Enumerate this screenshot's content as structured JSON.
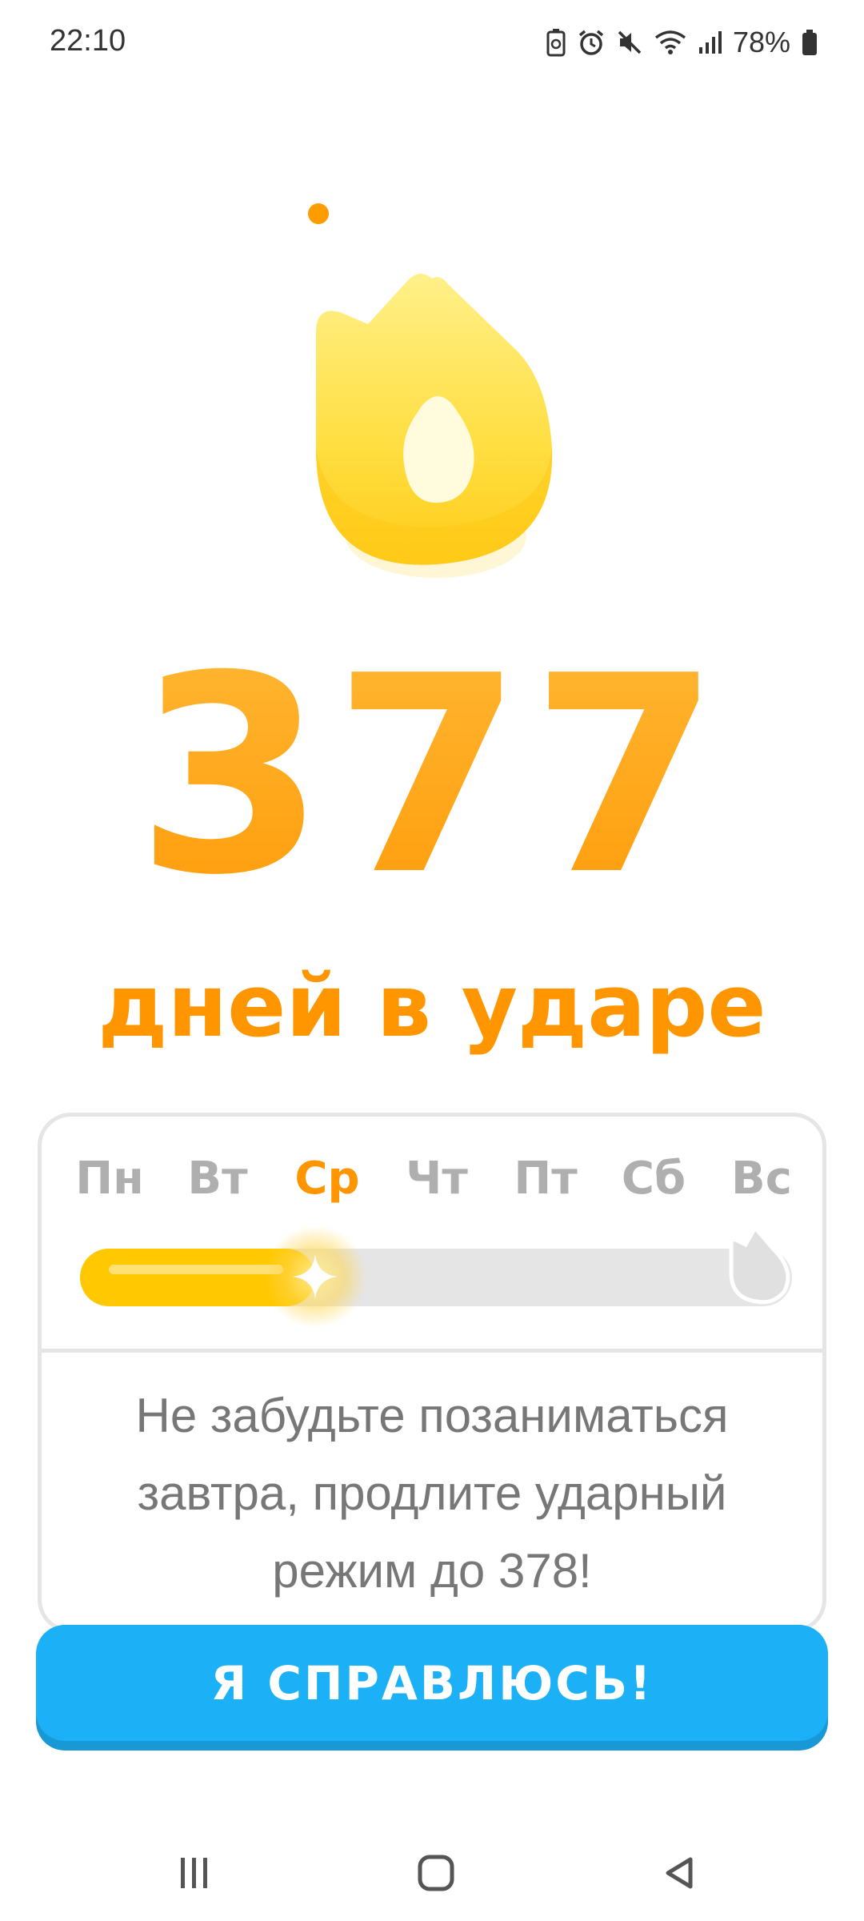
{
  "status_bar": {
    "time": "22:10",
    "battery_percent": "78%",
    "icons": [
      "battery-saver-icon",
      "alarm-icon",
      "mute-icon",
      "wifi-icon",
      "signal-icon",
      "battery-icon"
    ]
  },
  "streak": {
    "count": "377",
    "label": "дней в ударе",
    "flame_icon": "streak-flame-icon",
    "colors": {
      "accent": "#ff9600",
      "flame": "#ffc800"
    }
  },
  "week": {
    "days": [
      "Пн",
      "Вт",
      "Ср",
      "Чт",
      "Пт",
      "Сб",
      "Вс"
    ],
    "active_day": "Ср",
    "progress_fraction": 0.33,
    "reminder": "Не забудьте позаниматься завтра, продлите ударный режим до 378!"
  },
  "cta": {
    "label": "Я СПРАВЛЮСЬ!",
    "color": "#1cb0f6"
  },
  "nav": {
    "icons": [
      "recents-icon",
      "home-icon",
      "back-icon"
    ]
  }
}
